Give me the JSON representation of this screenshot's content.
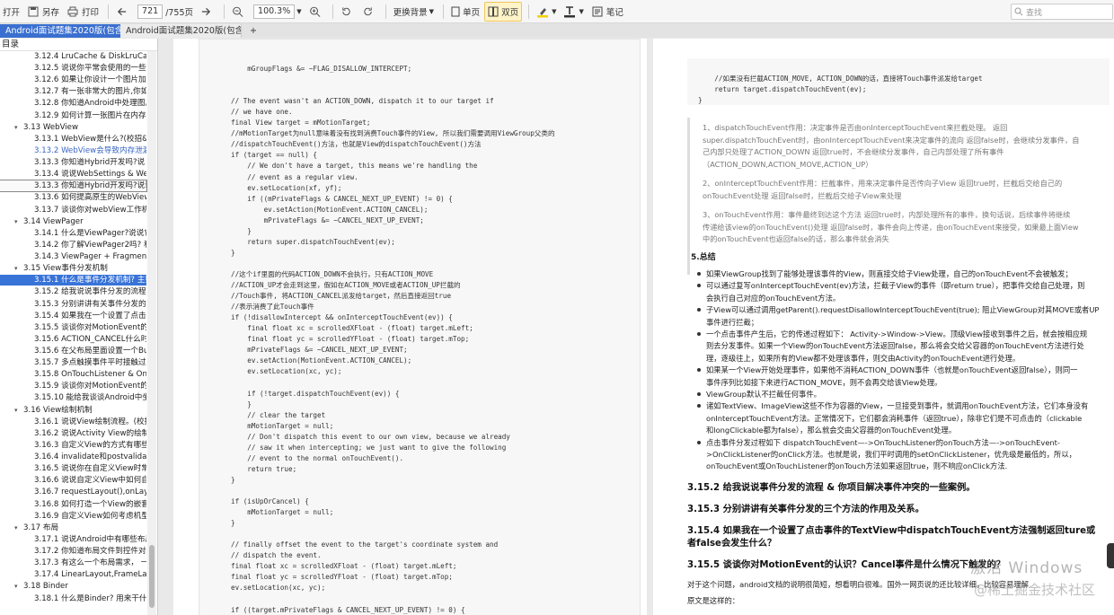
{
  "toolbar": {
    "open": "打开",
    "saveas": "另存",
    "print": "打印",
    "page_current": "721",
    "page_total": "/755页",
    "zoom": "100.3%",
    "background": "更换背景",
    "single": "单页",
    "double": "双页",
    "notes": "笔记",
    "search_placeholder": "查找"
  },
  "tabs": [
    {
      "label": "Android面试题集2020版(包含语",
      "active": true
    },
    {
      "label": "Android面试题集2020版(包含语",
      "active": false
    }
  ],
  "sidebar": {
    "title": "目录",
    "items": [
      {
        "label": "3.12.4 LruCache & DiskLruCach",
        "level": 2
      },
      {
        "label": "3.12.5 说说你平常会使用的一些第",
        "level": 2
      },
      {
        "label": "3.12.6 如果让你设计一个图片加载",
        "level": 2
      },
      {
        "label": "3.12.7 有一张非常大的图片,你如何",
        "level": 2
      },
      {
        "label": "3.12.8 你知道Android中处理图片",
        "level": 2
      },
      {
        "label": "3.12.9 如何计算一张图片在内存中",
        "level": 2
      },
      {
        "label": "3.13 WebView",
        "level": 1
      },
      {
        "label": "3.13.1 WebView是什么?(校招&",
        "level": 2
      },
      {
        "label": "3.13.2 WebView会导致内存泄漏",
        "level": 2,
        "state": "hl"
      },
      {
        "label": "3.13.3 你知道Hybrid开发吗?说",
        "level": 2
      },
      {
        "label": "3.13.4 说说WebSettings & Web",
        "level": 2
      },
      {
        "label": "3.13.3 你知道Hybrid开发吗?说说",
        "level": 2,
        "state": "box"
      },
      {
        "label": "3.13.6 如何提高原生的WebView",
        "level": 2
      },
      {
        "label": "3.13.7 谈谈你对webView工作机",
        "level": 2
      },
      {
        "label": "3.14 ViewPager",
        "level": 1
      },
      {
        "label": "3.14.1 什么是ViewPager?说说它",
        "level": 2
      },
      {
        "label": "3.14.2 你了解ViewPager2吗? 和",
        "level": 2
      },
      {
        "label": "3.14.3 ViewPager + Fragment组",
        "level": 2
      },
      {
        "label": "3.15 View事件分发机制",
        "level": 1
      },
      {
        "label": "3.15.1 什么是事件分发机制? 主要",
        "level": 2,
        "state": "sel"
      },
      {
        "label": "3.15.2 给我说说事件分发的流程 &",
        "level": 2
      },
      {
        "label": "3.15.3 分别讲讲有关事件分发的三",
        "level": 2
      },
      {
        "label": "3.15.4 如果我在一个设置了点击事",
        "level": 2
      },
      {
        "label": "3.15.5 谈谈你对MotionEvent的认",
        "level": 2
      },
      {
        "label": "3.15.6 ACTION_CANCEL什么时候",
        "level": 2
      },
      {
        "label": "3.15.6 在父布局里面设置一个Bu",
        "level": 2
      },
      {
        "label": "3.15.7 多点触摸事件平时接触过吗",
        "level": 2
      },
      {
        "label": "3.15.8 OnTouchListener & OnTc",
        "level": 2
      },
      {
        "label": "3.15.9 谈谈你对MotionEvent的认",
        "level": 2
      },
      {
        "label": "3.15.10 能给我谈谈Android中坐标",
        "level": 2
      },
      {
        "label": "3.16 View绘制机制",
        "level": 1
      },
      {
        "label": "3.16.1 说说View绘制流程。(校招&",
        "level": 2
      },
      {
        "label": "3.16.2 说说Activity View的绘制",
        "level": 2
      },
      {
        "label": "3.16.3 自定义View的方式有哪些?",
        "level": 2
      },
      {
        "label": "3.16.4 invalidate和postvalidate的",
        "level": 2
      },
      {
        "label": "3.16.5 说说你在自定义View时常常",
        "level": 2
      },
      {
        "label": "3.16.6 说说自定义View中如何自适",
        "level": 2
      },
      {
        "label": "3.16.7 requestLayout(),onLayout",
        "level": 2
      },
      {
        "label": "3.16.8 如何打造一个View的嵌套",
        "level": 2
      },
      {
        "label": "3.16.9 自定义View如何考虑机型适",
        "level": 2
      },
      {
        "label": "3.17 布局",
        "level": 1
      },
      {
        "label": "3.17.1 说说Android中有哪些布局",
        "level": 2
      },
      {
        "label": "3.17.2 你知道布局文件到控件对象",
        "level": 2
      },
      {
        "label": "3.17.3 有这么一个布局需求， 一个",
        "level": 2
      },
      {
        "label": "3.17.4 LinearLayout,FrameLayou",
        "level": 2
      },
      {
        "label": "3.18 Binder",
        "level": 1
      },
      {
        "label": "3.18.1 什么是Binder? 用来干什么",
        "level": 2
      }
    ]
  },
  "left_code": [
    "    mGroupFlags &= ~FLAG_DISALLOW_INTERCEPT;",
    "",
    "",
    "// The event wasn't an ACTION_DOWN, dispatch it to our target if",
    "// we have one.",
    "final View target = mMotionTarget;",
    "//mMotionTarget为null意味着没有找到消费Touch事件的View, 所以我们需要调用ViewGroup父类的",
    "//dispatchTouchEvent()方法，也就是View的dispatchTouchEvent()方法",
    "if (target == null) {",
    "    // We don't have a target, this means we're handling the",
    "    // event as a regular view.",
    "    ev.setLocation(xf, yf);",
    "    if ((mPrivateFlags & CANCEL_NEXT_UP_EVENT) != 0) {",
    "        ev.setAction(MotionEvent.ACTION_CANCEL);",
    "        mPrivateFlags &= ~CANCEL_NEXT_UP_EVENT;",
    "    }",
    "    return super.dispatchTouchEvent(ev);",
    "}",
    "",
    "//这个if里面的代码ACTION_DOWN不会执行，只有ACTION_MOVE",
    "//ACTION_UP才会走到这里，假如在ACTION_MOVE或者ACTION_UP拦截的",
    "//Touch事件, 将ACTION_CANCEL派发给target，然后直接返回true",
    "//表示消费了此Touch事件",
    "if (!disallowIntercept && onInterceptTouchEvent(ev)) {",
    "    final float xc = scrolledXFloat - (float) target.mLeft;",
    "    final float yc = scrolledYFloat - (float) target.mTop;",
    "    mPrivateFlags &= ~CANCEL_NEXT_UP_EVENT;",
    "    ev.setAction(MotionEvent.ACTION_CANCEL);",
    "    ev.setLocation(xc, yc);",
    "",
    "    if (!target.dispatchTouchEvent(ev)) {",
    "    }",
    "    // clear the target",
    "    mMotionTarget = null;",
    "    // Don't dispatch this event to our own view, because we already",
    "    // saw it when intercepting; we just want to give the following",
    "    // event to the normal onTouchEvent().",
    "    return true;",
    "}",
    "",
    "if (isUpOrCancel) {",
    "    mMotionTarget = null;",
    "}",
    "",
    "// finally offset the event to the target's coordinate system and",
    "// dispatch the event.",
    "final float xc = scrolledXFloat - (float) target.mLeft;",
    "final float yc = scrolledYFloat - (float) target.mTop;",
    "ev.setLocation(xc, yc);",
    "",
    "if ((target.mPrivateFlags & CANCEL_NEXT_UP_EVENT) != 0) {"
  ],
  "right_code": [
    "    //如果没有拦截ACTION_MOVE, ACTION_DOWN的话，直接将Touch事件派发给target",
    "    return target.dispatchTouchEvent(ev);",
    "}"
  ],
  "quote_lines": [
    "1、dispatchTouchEvent作用：决定事件是否由onInterceptTouchEvent来拦截处理。 返回",
    "super.dispatchTouchEvent时，由onInterceptTouchEvent来决定事件的流向 返回false时，会继续分发事件，自",
    "己内部只处理了ACTION_DOWN 返回true时，不会继续分发事件，自己内部处理了所有事件",
    "（ACTION_DOWN,ACTION_MOVE,ACTION_UP）",
    "",
    "2、onInterceptTouchEvent作用：拦截事件，用来决定事件是否传向子View 返回true时，拦截后交给自己的",
    "onTouchEvent处理 返回false时，拦截后交给子View来处理",
    "",
    "3、onTouchEvent作用：事件最终到达这个方法 返回true时，内部处理所有的事件，换句话说，后续事件将继续",
    "传递给该view的onTouchEvent()处理 返回false时，事件会向上传递，由onTouchEvent来接受，如果最上面View",
    "中的onTouchEvent也返回false的话，那么事件就会消失"
  ],
  "summary_title": "5.总结",
  "summary_lines": [
    {
      "b": true,
      "text": "如果ViewGroup找到了能够处理该事件的View，则直接交给子View处理，自己的onTouchEvent不会被触发；"
    },
    {
      "b": true,
      "text": "可以通过复写onInterceptTouchEvent(ev)方法，拦截子View的事件（即return true），把事件交给自己处理，则"
    },
    {
      "b": false,
      "text": "会执行自己对应的onTouchEvent方法。"
    },
    {
      "b": true,
      "text": "子View可以通过调用getParent().requestDisallowInterceptTouchEvent(true); 阻止ViewGroup对其MOVE或者UP"
    },
    {
      "b": false,
      "text": "事件进行拦截；"
    },
    {
      "b": true,
      "text": "一个点击事件产生后，它的传递过程如下： Activity->Window->View。顶级View接收到事件之后，就会按相应规"
    },
    {
      "b": false,
      "text": "则去分发事件。如果一个View的onTouchEvent方法返回false，那么将会交给父容器的onTouchEvent方法进行处"
    },
    {
      "b": false,
      "text": "理，逐级往上，如果所有的View都不处理该事件，则交由Activity的onTouchEvent进行处理。"
    },
    {
      "b": true,
      "text": "如果某一个View开始处理事件，如果他不消耗ACTION_DOWN事件（也就是onTouchEvent返回false），则同一"
    },
    {
      "b": false,
      "text": "事件序列比如接下来进行ACTION_MOVE，则不会再交给该View处理。"
    },
    {
      "b": true,
      "text": "ViewGroup默认不拦截任何事件。"
    },
    {
      "b": true,
      "text": "诸如TextView、ImageView这些不作为容器的View，一旦接受到事件，就调用onTouchEvent方法，它们本身没有"
    },
    {
      "b": false,
      "text": "onInterceptTouchEvent方法。正常情况下，它们都会消耗事件（返回true），除非它们是不可点击的（clickable"
    },
    {
      "b": false,
      "text": "和longClickable都为false），那么就会交由父容器的onTouchEvent处理。"
    },
    {
      "b": true,
      "text": "点击事件分发过程如下 dispatchTouchEvent—->OnTouchListener的onTouch方法—->onTouchEvent-"
    },
    {
      "b": false,
      "text": ">OnClickListener的onClick方法。也就是说，我们平时调用的setOnClickListener，优先级是最低的，所以，"
    },
    {
      "b": false,
      "text": "onTouchEvent或OnTouchListener的onTouch方法如果返回true，则不响应onClick方法."
    }
  ],
  "headings": [
    "3.15.2 给我说说事件分发的流程 & 你项目解决事件冲突的一些案例。",
    "3.15.3 分别讲讲有关事件分发的三个方法的作用及关系。",
    "3.15.4 如果我在一个设置了点击事件的TextView中dispatchTouchEvent方法强制返回ture或",
    "者false会发生什么？",
    "3.15.5 谈谈你对MotionEvent的认识？Cancel事件是什么情况下触发的？"
  ],
  "bottom_lines": [
    "对于这个问题，android文档的说明很简短，想看明白很难。国外一网页说的还比较详细，比较容易理解",
    "原文是这样的："
  ],
  "watermark_activate": "激活 Windows",
  "watermark_site": "@稀土掘金技术社区"
}
